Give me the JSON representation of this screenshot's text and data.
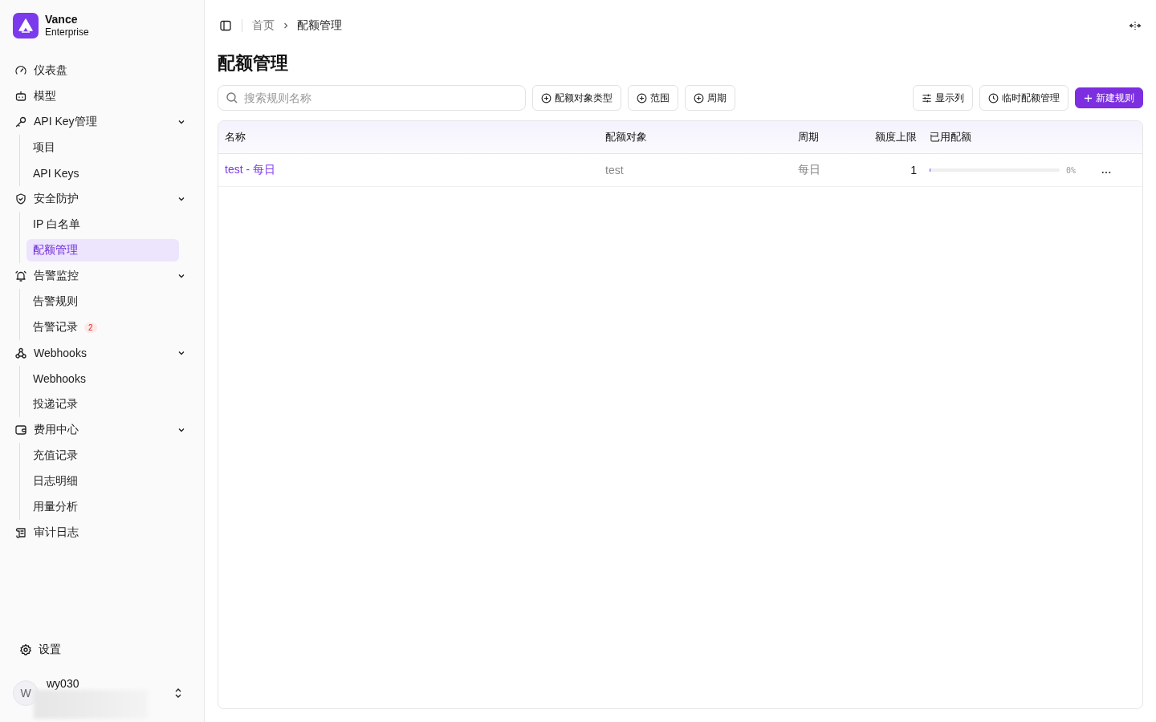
{
  "brand": {
    "name": "Vance",
    "subtitle": "Enterprise"
  },
  "nav": [
    {
      "label": "仪表盘",
      "kind": "gauge",
      "selected": false
    },
    {
      "label": "模型",
      "kind": "bot",
      "selected": false
    },
    {
      "label": "API Key管理",
      "kind": "key",
      "selected": false,
      "expanded": true,
      "children": [
        {
          "label": "项目",
          "selected": false
        },
        {
          "label": "API Keys",
          "selected": false
        }
      ]
    },
    {
      "label": "安全防护",
      "kind": "shield",
      "selected": false,
      "expanded": true,
      "children": [
        {
          "label": "IP 白名单",
          "selected": false
        },
        {
          "label": "配额管理",
          "selected": true
        }
      ]
    },
    {
      "label": "告警监控",
      "kind": "bell",
      "selected": false,
      "expanded": true,
      "children": [
        {
          "label": "告警规则",
          "selected": false
        },
        {
          "label": "告警记录",
          "selected": false,
          "badge": "2"
        }
      ]
    },
    {
      "label": "Webhooks",
      "kind": "webhook",
      "selected": false,
      "expanded": true,
      "children": [
        {
          "label": "Webhooks",
          "selected": false
        },
        {
          "label": "投递记录",
          "selected": false
        }
      ]
    },
    {
      "label": "费用中心",
      "kind": "wallet",
      "selected": false,
      "expanded": true,
      "children": [
        {
          "label": "充值记录",
          "selected": false
        },
        {
          "label": "日志明细",
          "selected": false
        },
        {
          "label": "用量分析",
          "selected": false
        }
      ]
    },
    {
      "label": "审计日志",
      "kind": "scroll",
      "selected": false
    }
  ],
  "settings": {
    "label": "设置"
  },
  "user": {
    "initial": "W",
    "name": "wy030"
  },
  "breadcrumb": [
    {
      "label": "首页"
    },
    {
      "label": "配额管理"
    }
  ],
  "title": "配额管理",
  "search": {
    "placeholder": "搜索规则名称"
  },
  "filters": [
    "配额对象类型",
    "范围",
    "周期"
  ],
  "actions": [
    {
      "label": "显示列",
      "kind": "columns"
    },
    {
      "label": "临时配额管理",
      "kind": "clock"
    },
    {
      "label": "新建规则",
      "kind": "primary"
    }
  ],
  "table": {
    "columns": [
      "名称",
      "配额对象",
      "周期",
      "额度上限",
      "已用配额"
    ],
    "rows": [
      {
        "name": "test - 每日",
        "target": "test",
        "period": "每日",
        "limit": "1",
        "used": {
          "level": 0,
          "reading": "0%"
        }
      }
    ]
  }
}
